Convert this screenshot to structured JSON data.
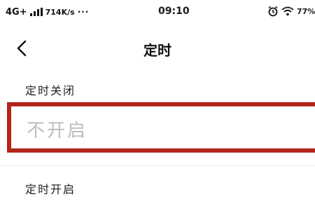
{
  "status_bar": {
    "network": "4G+",
    "speed": "714K/s",
    "more": "···",
    "time": "09:10",
    "battery": "77%"
  },
  "nav": {
    "back_icon": "chevron-left",
    "title": "定时"
  },
  "timer_off": {
    "label": "定时关闭",
    "value": "不开启"
  },
  "timer_on": {
    "label": "定时开启"
  },
  "colors": {
    "highlight_border": "#b3241a",
    "placeholder_text": "#bdbdbd"
  }
}
